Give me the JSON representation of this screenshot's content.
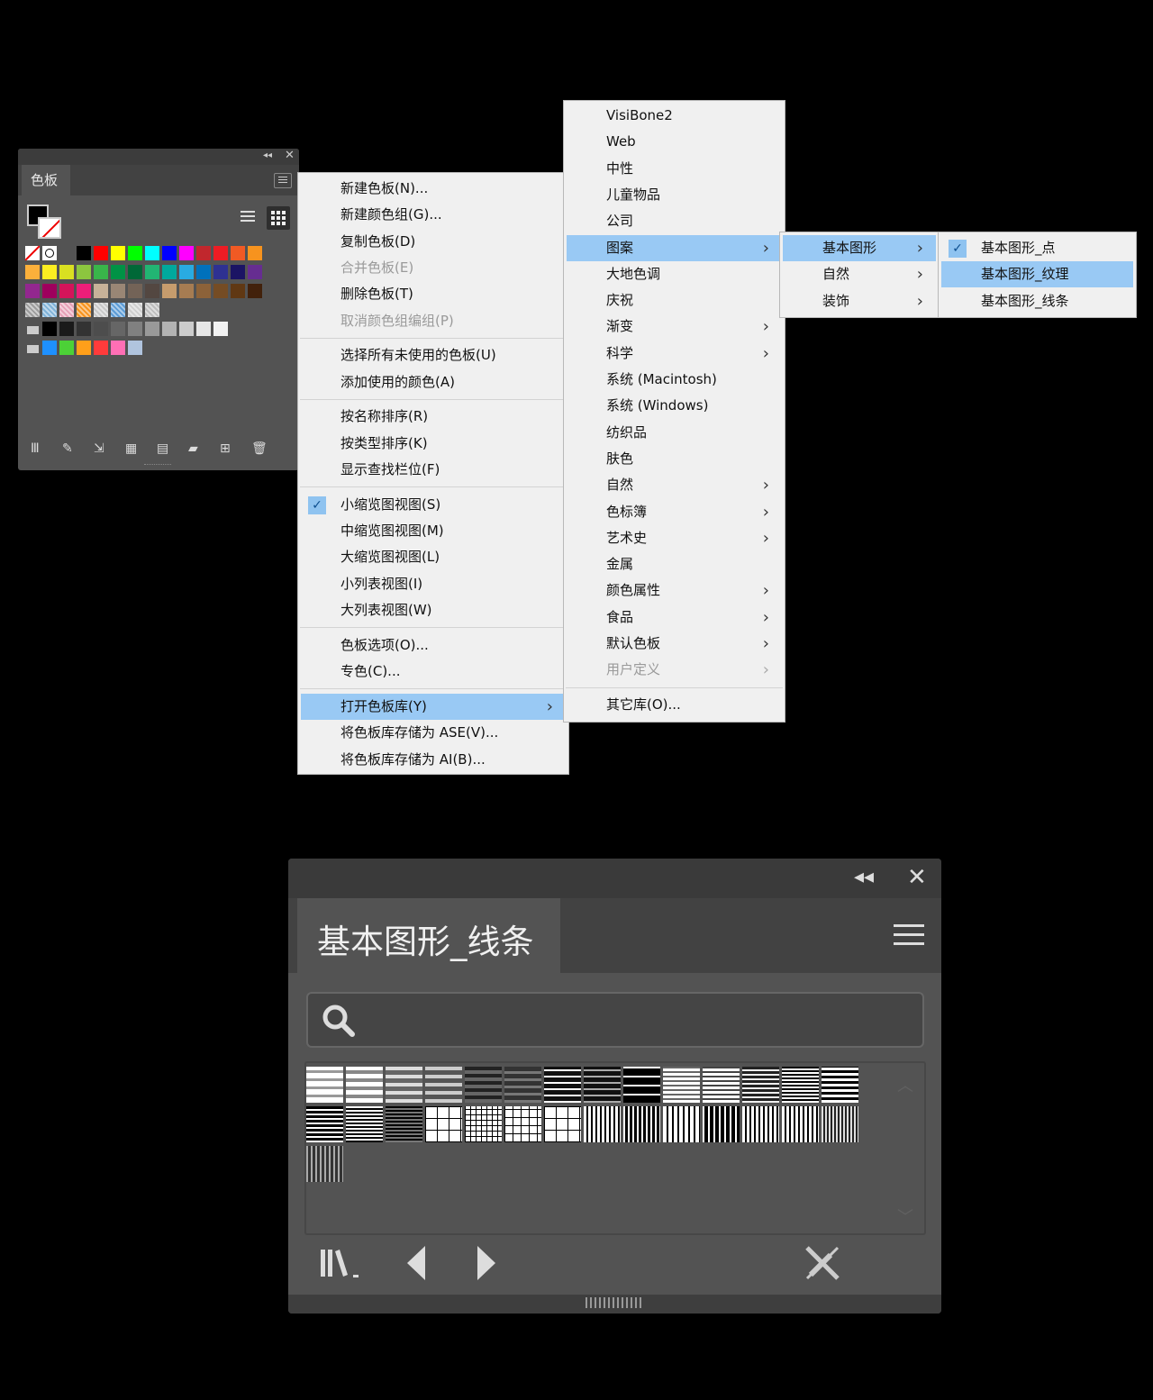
{
  "swatches_panel": {
    "tab_label": "色板",
    "header_buttons": [
      "collapse-icon",
      "close-icon"
    ],
    "view_buttons": [
      "list-view-icon",
      "grid-view-icon"
    ],
    "swatch_rows": [
      [
        "#ffffff",
        "#ffffff",
        "#ffffff",
        "#000000",
        "#ff0000",
        "#ffff00",
        "#00ff00",
        "#00ffff",
        "#0000ff",
        "#ff00ff",
        "#c1272d",
        "#ed1c24",
        "#f15a24",
        "#f7931e"
      ],
      [
        "#fbb03b",
        "#fcee21",
        "#d9e021",
        "#8cc63f",
        "#39b54a",
        "#009245",
        "#006837",
        "#22b573",
        "#00a99d",
        "#29abe2",
        "#0071bc",
        "#2e3192",
        "#1b1464",
        "#662d91"
      ],
      [
        "#93278f",
        "#9e005d",
        "#d4145a",
        "#ed1e79",
        "#c7b299",
        "#998675",
        "#736357",
        "#534741",
        "#c69c6d",
        "#a67c52",
        "#8c6239",
        "#754c24",
        "#603813",
        "#42210b"
      ],
      [
        "#9c9c9c",
        "#7fb2d8",
        "#e7a0b7",
        "#f7931e",
        "#c8c8c8",
        "#5b9bd5",
        "#cfcfcf",
        "#bdbdbd"
      ],
      [
        "#000000",
        "#1a1a1a",
        "#333333",
        "#4d4d4d",
        "#666666",
        "#808080",
        "#999999",
        "#b3b3b3",
        "#cccccc",
        "#e6e6e6",
        "#f2f2f2"
      ],
      [
        "#1e90ff",
        "#4cd137",
        "#ff9f1a",
        "#ff3b3b",
        "#ff6fb5",
        "#b0c4de"
      ]
    ],
    "bottom_tools": [
      "library-icon",
      "pen-icon",
      "import-icon",
      "swatch-group-icon",
      "options-icon",
      "folder-icon",
      "new-swatch-icon",
      "trash-icon"
    ]
  },
  "main_menu": {
    "items": [
      {
        "label": "新建色板(N)...",
        "disabled": false
      },
      {
        "label": "新建颜色组(G)...",
        "disabled": false
      },
      {
        "label": "复制色板(D)",
        "disabled": false
      },
      {
        "label": "合并色板(E)",
        "disabled": true
      },
      {
        "label": "删除色板(T)",
        "disabled": false
      },
      {
        "label": "取消颜色组编组(P)",
        "disabled": true
      },
      {
        "label": "选择所有未使用的色板(U)",
        "disabled": false
      },
      {
        "label": "添加使用的颜色(A)",
        "disabled": false
      },
      {
        "label": "按名称排序(R)",
        "disabled": false
      },
      {
        "label": "按类型排序(K)",
        "disabled": false
      },
      {
        "label": "显示查找栏位(F)",
        "disabled": false
      },
      {
        "label": "小缩览图视图(S)",
        "checked": true
      },
      {
        "label": "中缩览图视图(M)",
        "disabled": false
      },
      {
        "label": "大缩览图视图(L)",
        "disabled": false
      },
      {
        "label": "小列表视图(I)",
        "disabled": false
      },
      {
        "label": "大列表视图(W)",
        "disabled": false
      },
      {
        "label": "色板选项(O)...",
        "disabled": false
      },
      {
        "label": "专色(C)...",
        "disabled": false
      },
      {
        "label": "打开色板库(Y)",
        "highlighted": true,
        "submenu": true
      },
      {
        "label": "将色板库存储为 ASE(V)...",
        "disabled": false
      },
      {
        "label": "将色板库存储为 AI(B)...",
        "disabled": false
      }
    ]
  },
  "library_menu": {
    "items": [
      {
        "label": "VisiBone2"
      },
      {
        "label": "Web"
      },
      {
        "label": "中性"
      },
      {
        "label": "儿童物品"
      },
      {
        "label": "公司"
      },
      {
        "label": "图案",
        "highlighted": true,
        "submenu": true
      },
      {
        "label": "大地色调"
      },
      {
        "label": "庆祝"
      },
      {
        "label": "渐变",
        "submenu": true
      },
      {
        "label": "科学",
        "submenu": true
      },
      {
        "label": "系统 (Macintosh)"
      },
      {
        "label": "系统 (Windows)"
      },
      {
        "label": "纺织品"
      },
      {
        "label": "肤色"
      },
      {
        "label": "自然",
        "submenu": true
      },
      {
        "label": "色标簿",
        "submenu": true
      },
      {
        "label": "艺术史",
        "submenu": true
      },
      {
        "label": "金属"
      },
      {
        "label": "颜色属性",
        "submenu": true
      },
      {
        "label": "食品",
        "submenu": true
      },
      {
        "label": "默认色板",
        "submenu": true
      },
      {
        "label": "用户定义",
        "submenu": true,
        "disabled": true
      },
      {
        "label": "其它库(O)..."
      }
    ]
  },
  "pattern_menu": {
    "items": [
      {
        "label": "基本图形",
        "highlighted": true,
        "submenu": true
      },
      {
        "label": "自然",
        "submenu": true
      },
      {
        "label": "装饰",
        "submenu": true
      }
    ]
  },
  "basic_shapes_menu": {
    "items": [
      {
        "label": "基本图形_点",
        "checked": true
      },
      {
        "label": "基本图形_纹理",
        "highlighted": true
      },
      {
        "label": "基本图形_线条"
      }
    ]
  },
  "library_panel": {
    "tab_label": "基本图形_线条",
    "search_placeholder": "",
    "pattern_count": 29,
    "bottom_tools": [
      "library-icon",
      "previous-library-icon",
      "next-library-icon",
      "eyedropper-disabled-icon"
    ]
  }
}
